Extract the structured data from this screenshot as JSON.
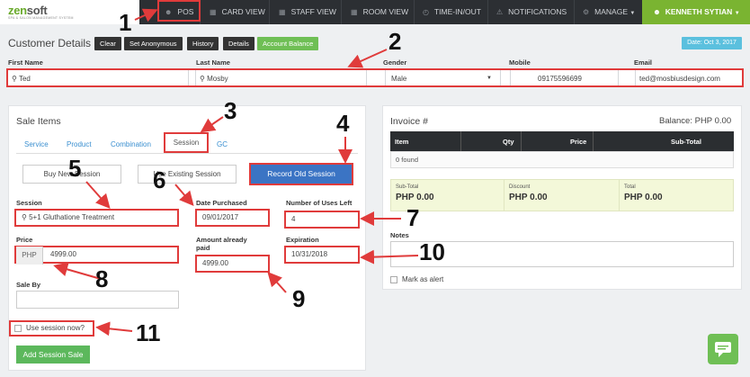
{
  "nav": {
    "logo_prefix": "zen",
    "logo_suffix": "soft",
    "logo_tagline": "SPA & SALON MANAGEMENT SYSTEM",
    "items": [
      "POS",
      "CARD VIEW",
      "STAFF VIEW",
      "ROOM VIEW",
      "TIME-IN/OUT",
      "NOTIFICATIONS",
      "MANAGE"
    ],
    "user": "KENNETH SYTIAN"
  },
  "customer": {
    "title": "Customer Details",
    "buttons": [
      "Clear",
      "Set Anonymous",
      "History",
      "Details",
      "Account Balance"
    ],
    "date": "Date: Oct 3, 2017",
    "labels": {
      "first_name": "First Name",
      "last_name": "Last Name",
      "gender": "Gender",
      "mobile": "Mobile",
      "email": "Email"
    },
    "values": {
      "first_name": "Ted",
      "last_name": "Mosby",
      "gender": "Male",
      "mobile": "09175596699",
      "email": "ted@mosbiusdesign.com"
    }
  },
  "sale": {
    "title": "Sale Items",
    "tabs": [
      "Service",
      "Product",
      "Combination",
      "Session",
      "GC"
    ],
    "buttons": {
      "buy_new": "Buy New Session",
      "use_existing": "Use Existing Session",
      "record_old": "Record Old Session"
    },
    "labels": {
      "session": "Session",
      "date_purchased": "Date Purchased",
      "uses_left": "Number of Uses Left",
      "price": "Price",
      "amount_paid": "Amount already paid",
      "expiration": "Expiration",
      "sale_by": "Sale By",
      "use_now": "Use session now?"
    },
    "values": {
      "session": "5+1 Gluthatione Treatment",
      "date_purchased": "09/01/2017",
      "uses_left": "4",
      "price_currency": "PHP",
      "price": "4999.00",
      "amount_paid": "4999.00",
      "expiration": "10/31/2018"
    },
    "add_button": "Add Session Sale"
  },
  "invoice": {
    "title": "Invoice #",
    "balance": "Balance: PHP 0.00",
    "columns": [
      "Item",
      "Qty",
      "Price",
      "Sub-Total"
    ],
    "empty_text": "0 found",
    "totals": [
      {
        "label": "Sub-Total",
        "value": "PHP 0.00"
      },
      {
        "label": "Discount",
        "value": "PHP 0.00"
      },
      {
        "label": "Total",
        "value": "PHP 0.00"
      }
    ],
    "notes_label": "Notes",
    "alert_label": "Mark as alert"
  },
  "annotations": [
    "1",
    "2",
    "3",
    "4",
    "5",
    "6",
    "7",
    "8",
    "9",
    "10",
    "11"
  ],
  "colors": {
    "nav_bg": "#2c2f33",
    "user_green": "#7ab431",
    "accent_blue": "#3b74c4",
    "annotation_red": "#e03b3b"
  }
}
